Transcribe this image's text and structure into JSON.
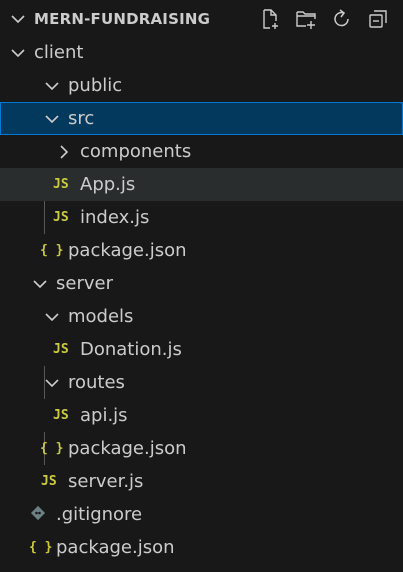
{
  "explorer": {
    "title": "MERN-FUNDRAISING",
    "actions": [
      {
        "icon": "new-file-icon"
      },
      {
        "icon": "new-folder-icon"
      },
      {
        "icon": "refresh-icon"
      },
      {
        "icon": "collapse-all-icon"
      }
    ]
  },
  "tree": {
    "client": "client",
    "public": "public",
    "src": "src",
    "components": "components",
    "app_js": "App.js",
    "index_js": "index.js",
    "client_package": "package.json",
    "server": "server",
    "models": "models",
    "donation_js": "Donation.js",
    "routes": "routes",
    "api_js": "api.js",
    "server_package": "package.json",
    "server_js": "server.js",
    "gitignore": ".gitignore",
    "root_package": "package.json"
  },
  "icons": {
    "js_glyph": "JS",
    "json_glyph": "{ }"
  },
  "colors": {
    "background": "#181818",
    "text": "#cccccc",
    "selection_bg": "#04395e",
    "selection_border": "#0078d4",
    "hover_bg": "#2a2d2e",
    "js_icon": "#cbcb41",
    "json_icon": "#cbcb41",
    "gitignore_icon": "#6d8086"
  }
}
